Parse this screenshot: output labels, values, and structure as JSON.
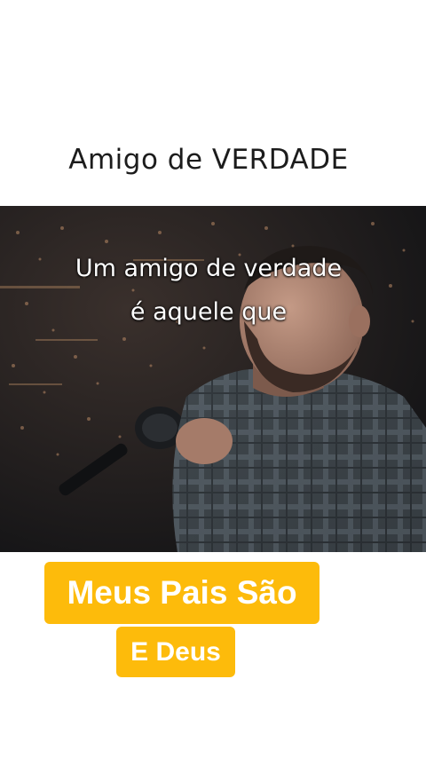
{
  "header": {
    "title": "Amigo de VERDADE"
  },
  "video": {
    "subtitle_line_1": "Um amigo de verdade",
    "subtitle_line_2": "é aquele que"
  },
  "captions": {
    "primary": "Meus Pais São",
    "secondary": "E Deus"
  },
  "colors": {
    "badge_background": "#fdbb0b",
    "badge_text": "#ffffff",
    "title_text": "#1c1c1c",
    "page_background": "#ffffff"
  }
}
